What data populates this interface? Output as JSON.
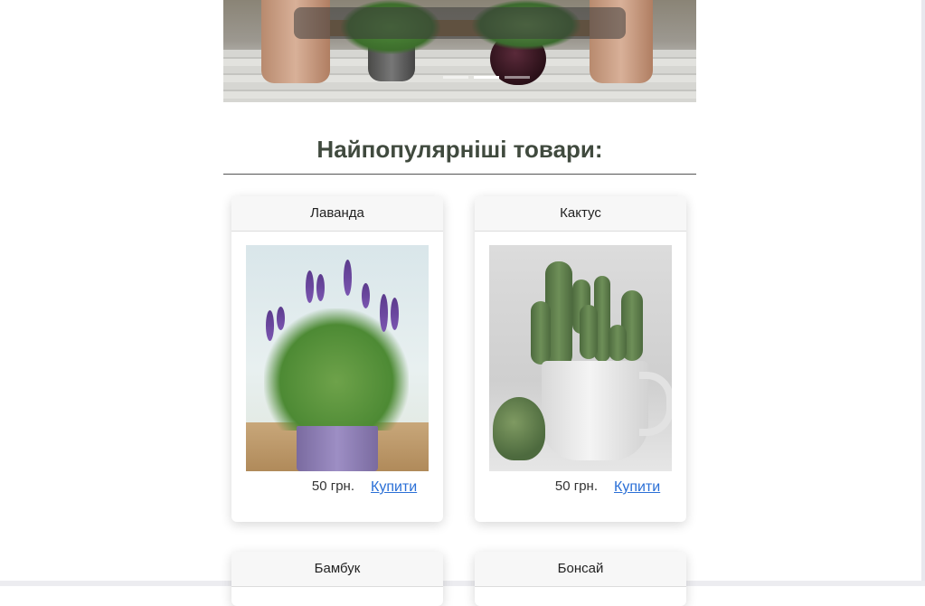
{
  "section": {
    "title": "Найпопулярніші товари:"
  },
  "carousel": {
    "indicators": 3,
    "active_index": 1
  },
  "products": [
    {
      "name": "Лаванда",
      "price": "50 грн.",
      "buy_label": "Купити",
      "image": "lavender-photo"
    },
    {
      "name": "Кактус",
      "price": "50 грн.",
      "buy_label": "Купити",
      "image": "cactus-photo"
    },
    {
      "name": "Бамбук"
    },
    {
      "name": "Бонсай"
    }
  ],
  "colors": {
    "title": "#404a3e",
    "link": "#2a6fd6",
    "card_header_bg": "#f7f7f7"
  }
}
